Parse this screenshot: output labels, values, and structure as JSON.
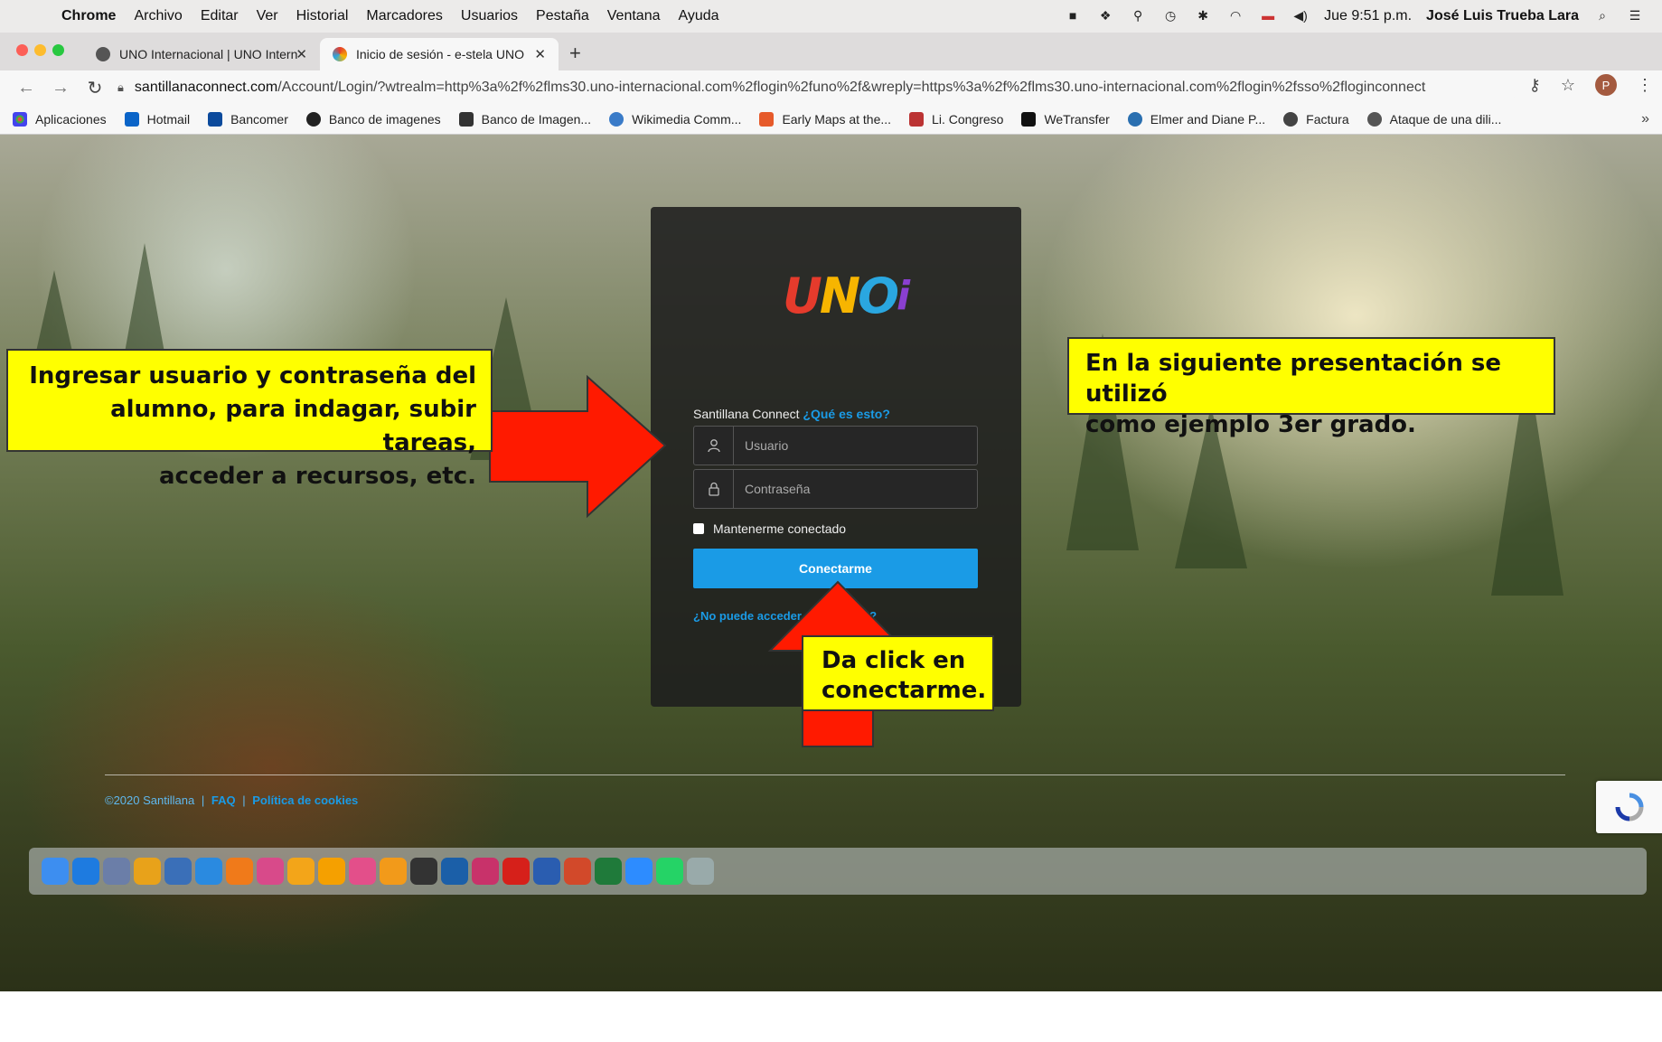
{
  "menubar": {
    "app": "Chrome",
    "items": [
      "Archivo",
      "Editar",
      "Ver",
      "Historial",
      "Marcadores",
      "Usuarios",
      "Pestaña",
      "Ventana",
      "Ayuda"
    ],
    "clock": "Jue 9:51 p.m.",
    "user": "José Luis Trueba Lara"
  },
  "tabs": [
    {
      "title": "UNO Internacional | UNO Intern",
      "active": false
    },
    {
      "title": "Inicio de sesión - e-stela UNO",
      "active": true
    }
  ],
  "address": {
    "host": "santillanaconnect.com",
    "path": "/Account/Login/?wtrealm=http%3a%2f%2flms30.uno-internacional.com%2flogin%2funo%2f&wreply=https%3a%2f%2flms30.uno-internacional.com%2flogin%2fsso%2floginconnect",
    "avatar": "P"
  },
  "bookmarks": [
    "Aplicaciones",
    "Hotmail",
    "Bancomer",
    "Banco de imagenes",
    "Banco de Imagen...",
    "Wikimedia Comm...",
    "Early Maps at the...",
    "Li. Congreso",
    "WeTransfer",
    "Elmer and Diane P...",
    "Factura",
    "Ataque de una dili..."
  ],
  "login": {
    "logo_letters": [
      "U",
      "N",
      "O",
      "i"
    ],
    "label": "Santillana Connect",
    "help_link": "¿Qué es esto?",
    "username_placeholder": "Usuario",
    "password_placeholder": "Contraseña",
    "remember": "Mantenerme conectado",
    "submit": "Conectarme",
    "forgot": "¿No puede acceder a su cuenta?"
  },
  "footer": {
    "copyright": "©2020 Santillana",
    "faq": "FAQ",
    "cookies": "Política de cookies"
  },
  "annotations": {
    "left": [
      "Ingresar usuario y contraseña del",
      "alumno, para indagar, subir tareas,",
      "acceder a recursos, etc."
    ],
    "right": [
      "En la siguiente presentación se utilizó",
      "como ejemplo 3er grado."
    ],
    "bottom": [
      "Da click en",
      "conectarme."
    ]
  },
  "dock_apps": [
    "finder-icon",
    "appstore-icon",
    "launchpad-icon",
    "chrome-icon",
    "preview-icon",
    "safari-icon",
    "firefox-icon",
    "photos-icon",
    "illustrator-icon",
    "garageband-icon",
    "itunes-icon",
    "books-icon",
    "bridge-icon",
    "photoshop-icon",
    "indesign-icon",
    "acrobat-icon",
    "word-icon",
    "powerpoint-icon",
    "excel-icon",
    "zoom-icon",
    "whatsapp-icon",
    "trash-icon"
  ]
}
